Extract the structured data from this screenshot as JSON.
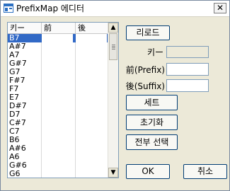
{
  "window": {
    "title": "PrefixMap 에디터",
    "close_glyph": "✕"
  },
  "list": {
    "columns": [
      "키ー",
      "前",
      "後"
    ],
    "rows": [
      "B7",
      "A#7",
      "A7",
      "G#7",
      "G7",
      "F#7",
      "F7",
      "E7",
      "D#7",
      "D7",
      "C#7",
      "C7",
      "B6",
      "A#6",
      "A6",
      "G#6",
      "G6"
    ],
    "selected": "B7"
  },
  "buttons": {
    "reload": "리로드",
    "set": "세트",
    "reset": "초기화",
    "select_all": "전부 선택",
    "ok": "OK",
    "cancel": "취소"
  },
  "fields": {
    "key_label": "키ー",
    "prefix_label": "前(Prefix)",
    "suffix_label": "後(Suffix)",
    "key_value": "",
    "prefix_value": "",
    "suffix_value": ""
  },
  "scrollbar": {
    "up_glyph": "▲",
    "down_glyph": "▼"
  }
}
